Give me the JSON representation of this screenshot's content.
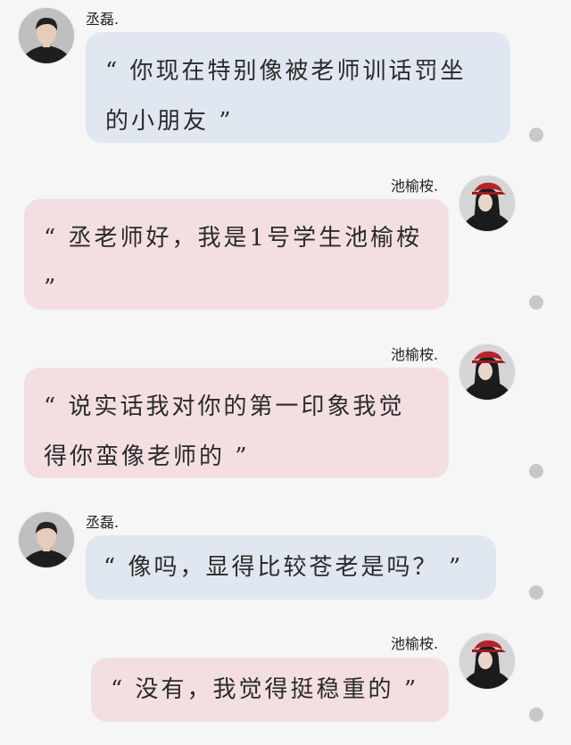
{
  "chat": {
    "messages": [
      {
        "sender": "丞磊.",
        "side": "left",
        "avatar": "male-avatar",
        "text": "“ 你现在特别像被老师训话罚坐的小朋友 ”"
      },
      {
        "sender": "池榆桉.",
        "side": "right",
        "avatar": "female-avatar",
        "text": "“ 丞老师好，我是1号学生池榆桉 ”"
      },
      {
        "sender": "池榆桉.",
        "side": "right",
        "avatar": "female-avatar",
        "text": "“ 说实话我对你的第一印象我觉得你蛮像老师的 ”"
      },
      {
        "sender": "丞磊.",
        "side": "left",
        "avatar": "male-avatar",
        "text": "“ 像吗，显得比较苍老是吗？ ”"
      },
      {
        "sender": "池榆桉.",
        "side": "right",
        "avatar": "female-avatar",
        "text": "“ 没有，我觉得挺稳重的 ”"
      }
    ]
  },
  "colors": {
    "background": "#f6f6f6",
    "left_bubble": "#e1e7f1",
    "right_bubble": "#f3dfe2",
    "status_dot": "#c8c8c8"
  }
}
